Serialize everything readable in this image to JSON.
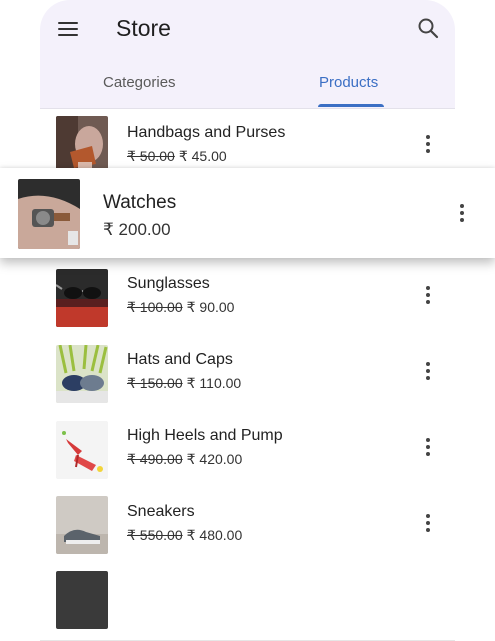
{
  "appbar": {
    "title": "Store"
  },
  "tabs": [
    {
      "label": "Categories",
      "selected": false
    },
    {
      "label": "Products",
      "selected": true
    }
  ],
  "colors": {
    "accent": "#3b6fc4",
    "header_bg": "#f4f1fb"
  },
  "icons": {
    "menu": "menu-icon",
    "search": "search-icon",
    "more": "more-vert-icon"
  },
  "products": [
    {
      "name": "Handbags and Purses",
      "old_price": "₹ 50.00",
      "price": "₹ 45.00"
    },
    {
      "name": "Watches",
      "old_price": "",
      "price": "₹ 200.00",
      "dragging": true
    },
    {
      "name": "Sunglasses",
      "old_price": "₹ 100.00",
      "price": "₹ 90.00"
    },
    {
      "name": "Hats and Caps",
      "old_price": "₹ 150.00",
      "price": "₹ 110.00"
    },
    {
      "name": "High Heels and Pump",
      "old_price": "₹ 490.00",
      "price": "₹ 420.00"
    },
    {
      "name": "Sneakers",
      "old_price": "₹ 550.00",
      "price": "₹ 480.00"
    }
  ]
}
